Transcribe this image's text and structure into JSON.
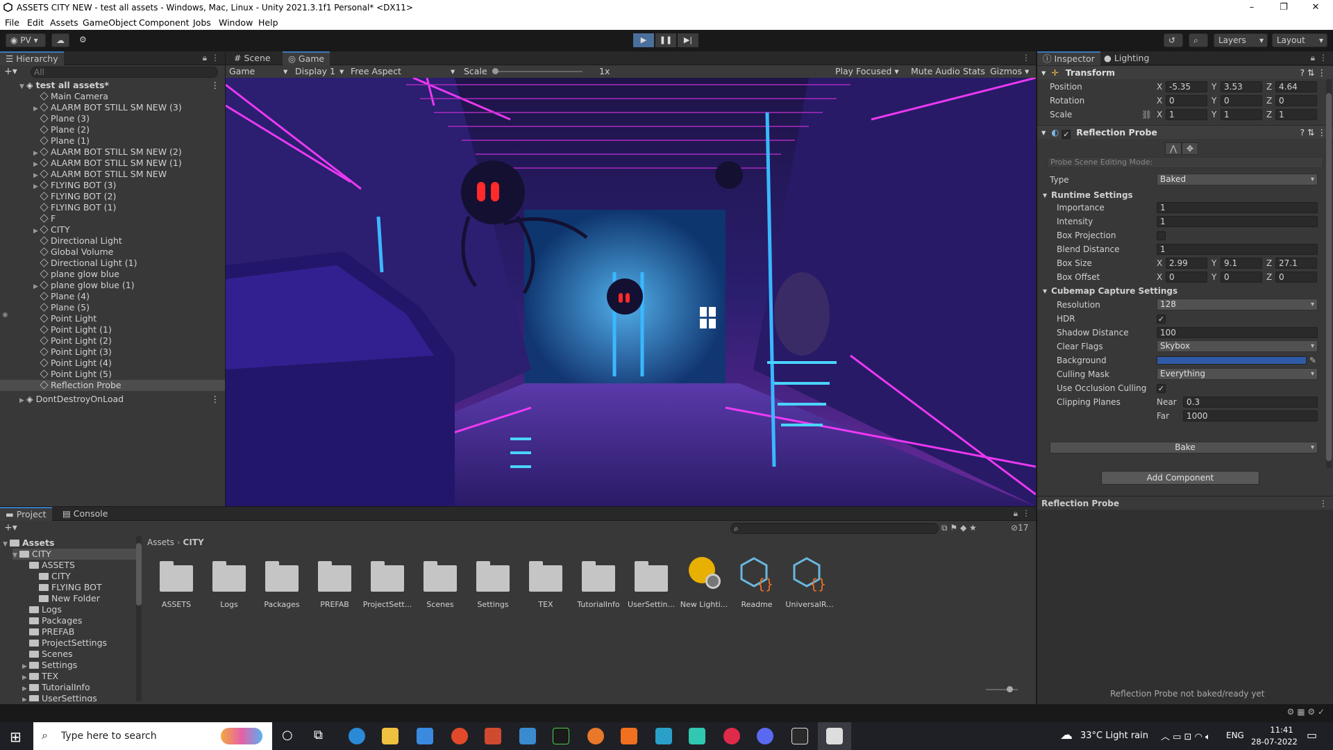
{
  "window": {
    "title": "ASSETS CITY NEW - test all assets - Windows, Mac, Linux - Unity 2021.3.1f1 Personal* <DX11>",
    "minimize": "–",
    "maximize": "❐",
    "close": "✕"
  },
  "menu": [
    "File",
    "Edit",
    "Assets",
    "GameObject",
    "Component",
    "Jobs",
    "Window",
    "Help"
  ],
  "toolbar": {
    "account": "PV",
    "layers": "Layers",
    "layout": "Layout"
  },
  "hierarchy": {
    "tab": "Hierarchy",
    "search_placeholder": "All",
    "scene": "test all assets*",
    "items": [
      "Main Camera",
      "ALARM BOT STILL SM NEW (3)",
      "Plane (3)",
      "Plane (2)",
      "Plane (1)",
      "ALARM BOT STILL SM NEW (2)",
      "ALARM BOT STILL SM NEW (1)",
      "ALARM BOT STILL SM NEW",
      "FLYING BOT (3)",
      "FLYING BOT (2)",
      "FLYING BOT (1)",
      "F",
      "CITY",
      "Directional Light",
      "Global Volume",
      "Directional Light (1)",
      "plane glow blue",
      "plane glow blue (1)",
      "Plane (4)",
      "Plane (5)",
      "Point Light",
      "Point Light (1)",
      "Point Light (2)",
      "Point Light (3)",
      "Point Light (4)",
      "Point Light (5)",
      "Reflection Probe"
    ],
    "dont_destroy": "DontDestroyOnLoad"
  },
  "game": {
    "tab_scene": "Scene",
    "tab_game": "Game",
    "view": "Game",
    "display": "Display 1",
    "aspect": "Free Aspect",
    "scale_label": "Scale",
    "scale_value": "1x",
    "play_focused": "Play Focused",
    "mute": "Mute Audio",
    "stats": "Stats",
    "gizmos": "Gizmos"
  },
  "inspector": {
    "tab": "Inspector",
    "tab2": "Lighting",
    "transform": {
      "title": "Transform",
      "position": "Position",
      "rotation": "Rotation",
      "scale": "Scale",
      "px": "-5.35",
      "py": "3.53",
      "pz": "4.64",
      "rx": "0",
      "ry": "0",
      "rz": "0",
      "sx": "1",
      "sy": "1",
      "sz": "1"
    },
    "probe": {
      "title": "Reflection Probe",
      "edit_mode": "Probe Scene Editing Mode:",
      "type_label": "Type",
      "type": "Baked",
      "runtime": "Runtime Settings",
      "importance_l": "Importance",
      "importance": "1",
      "intensity_l": "Intensity",
      "intensity": "1",
      "boxproj_l": "Box Projection",
      "blend_l": "Blend Distance",
      "blend": "1",
      "boxsize_l": "Box Size",
      "bsx": "2.99",
      "bsy": "9.1",
      "bsz": "27.1",
      "boxoff_l": "Box Offset",
      "box": "0",
      "boy": "0",
      "boz": "0",
      "cubemap": "Cubemap Capture Settings",
      "res_l": "Resolution",
      "res": "128",
      "hdr_l": "HDR",
      "shadow_l": "Shadow Distance",
      "shadow": "100",
      "clear_l": "Clear Flags",
      "clear": "Skybox",
      "bg_l": "Background",
      "cull_l": "Culling Mask",
      "cull": "Everything",
      "occl_l": "Use Occlusion Culling",
      "clip_l": "Clipping Planes",
      "near_l": "Near",
      "near": "0.3",
      "far_l": "Far",
      "far": "1000",
      "bake": "Bake"
    },
    "add_component": "Add Component",
    "preview_title": "Reflection Probe",
    "status": "Reflection Probe not baked/ready yet",
    "bg_color": "#2f5aa8"
  },
  "project": {
    "tab": "Project",
    "tab2": "Console",
    "path1": "Assets",
    "path2": "CITY",
    "count": "17",
    "tree": [
      [
        "Assets",
        0,
        true
      ],
      [
        "CITY",
        1,
        true
      ],
      [
        "ASSETS",
        2,
        false
      ],
      [
        "CITY",
        3,
        false
      ],
      [
        "FLYING BOT",
        3,
        false
      ],
      [
        "New Folder",
        3,
        false
      ],
      [
        "Logs",
        2,
        false
      ],
      [
        "Packages",
        2,
        false
      ],
      [
        "PREFAB",
        2,
        false
      ],
      [
        "ProjectSettings",
        2,
        false
      ],
      [
        "Scenes",
        2,
        false
      ],
      [
        "Settings",
        2,
        false
      ],
      [
        "TEX",
        2,
        false
      ],
      [
        "TutorialInfo",
        2,
        false
      ],
      [
        "UserSettings",
        2,
        false
      ]
    ],
    "assets": [
      "ASSETS",
      "Logs",
      "Packages",
      "PREFAB",
      "ProjectSett...",
      "Scenes",
      "Settings",
      "TEX",
      "TutorialInfo",
      "UserSettin...",
      "New Lighti...",
      "Readme",
      "UniversalR..."
    ]
  },
  "taskbar": {
    "search": "Type here to search",
    "weather": "33°C  Light rain",
    "lang": "ENG",
    "time": "11:41",
    "date": "28-07-2022"
  }
}
